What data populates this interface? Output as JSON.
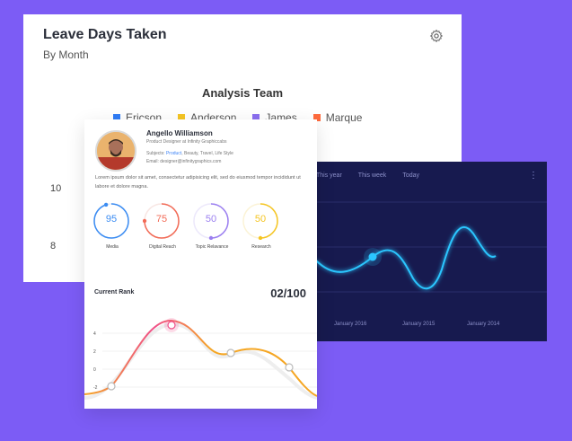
{
  "leave_card": {
    "title": "Leave Days Taken",
    "subtitle": "By Month",
    "chart_title": "Analysis Team",
    "legend": [
      {
        "label": "Ericson",
        "color": "#2f7cf6"
      },
      {
        "label": "Anderson",
        "color": "#f5c523"
      },
      {
        "label": "James",
        "color": "#8b6ff0"
      },
      {
        "label": "Marque",
        "color": "#ff6b3d"
      }
    ],
    "y_ticks": [
      "10",
      "8"
    ]
  },
  "dark_card": {
    "tabs": [
      "This year",
      "This week",
      "Today"
    ],
    "menu_icon": "more-vertical-icon",
    "x_labels": [
      "January 2016",
      "January 2015",
      "January 2014"
    ],
    "line_color": "#2bc6ff"
  },
  "profile": {
    "name": "Angello Williamson",
    "role": "Product Designer at Infinity Graphiccabs",
    "subjects_prefix": "Subjects: ",
    "subjects_highlight": "Product",
    "subjects_rest": ", Beauty, Travel, Life Style",
    "email": "Email: designer@infinitygraphics.com",
    "bio": "Lorem ipsum dolor sit amet, consectetur adipisicing elit, sed do eiusmod tempor incididunt ut labore et dolore magna.",
    "metrics": [
      {
        "value": "95",
        "label": "Media",
        "color": "#3b8cf2",
        "fraction": 0.95
      },
      {
        "value": "75",
        "label": "Digital Reach",
        "color": "#f26b57",
        "fraction": 0.75
      },
      {
        "value": "50",
        "label": "Topic Relavance",
        "color": "#9c80f0",
        "fraction": 0.5
      },
      {
        "value": "50",
        "label": "Research",
        "color": "#f5c523",
        "fraction": 0.5
      }
    ],
    "rank_label": "Current Rank",
    "rank_value": "02/100",
    "rank_y_ticks": [
      "4",
      "2",
      "0",
      "-2"
    ]
  }
}
